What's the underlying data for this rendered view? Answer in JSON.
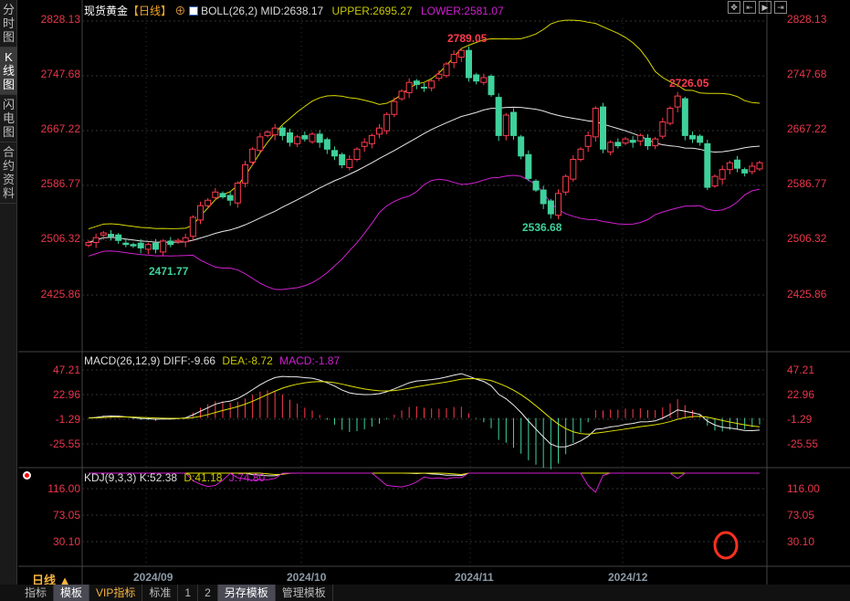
{
  "sidebar": {
    "items": [
      {
        "label": "分时图"
      },
      {
        "label": "K线图"
      },
      {
        "label": "闪电图"
      },
      {
        "label": "合约资料"
      }
    ]
  },
  "header": {
    "instrument": "现货黄金",
    "period": "【日线】",
    "indicator": "BOLL(26,2)",
    "mid": "MID:2638.17",
    "upper": "UPPER:2695.27",
    "lower": "LOWER:2581.07"
  },
  "price_axis": [
    "2828.13",
    "2747.68",
    "2667.22",
    "2586.77",
    "2506.32",
    "2425.86"
  ],
  "annotations": {
    "high": "2789.05",
    "low_left": "2471.77",
    "low_mid": "2536.68",
    "high_right": "2726.05"
  },
  "macd": {
    "title": "MACD(26,12,9)",
    "diff": "DIFF:-9.66",
    "dea": "DEA:-8.72",
    "macd": "MACD:-1.87",
    "axis": [
      "47.21",
      "22.96",
      "-1.29",
      "-25.55"
    ]
  },
  "kdj": {
    "title": "KDJ(9,3,3)",
    "k": "K:52.38",
    "d": "D:41.18",
    "j": "J:74.80",
    "axis": [
      "116.00",
      "73.05",
      "30.10"
    ]
  },
  "period_label": "日线 ▲",
  "dates": [
    "2024/09",
    "2024/10",
    "2024/11",
    "2024/12"
  ],
  "bottom_tabs": [
    "指标",
    "模板",
    "VIP指标",
    "标准",
    "1",
    "2",
    "另存模板",
    "管理模板"
  ],
  "colors": {
    "up": "#ff3b4e",
    "down": "#3fd19b",
    "mid": "#e8e8e8",
    "upper": "#d8d800",
    "lower": "#d020d0"
  },
  "chart_data": {
    "type": "candlestick",
    "ylim": [
      2425.86,
      2828.13
    ],
    "closes": [
      2503,
      2510,
      2517,
      2512,
      2506,
      2500,
      2498,
      2495,
      2500,
      2493,
      2505,
      2500,
      2506,
      2510,
      2540,
      2557,
      2565,
      2577,
      2570,
      2565,
      2590,
      2617,
      2640,
      2658,
      2665,
      2671,
      2660,
      2650,
      2658,
      2655,
      2662,
      2650,
      2640,
      2630,
      2617,
      2625,
      2640,
      2650,
      2660,
      2671,
      2691,
      2710,
      2725,
      2738,
      2735,
      2730,
      2740,
      2750,
      2765,
      2779,
      2785,
      2745,
      2740,
      2745,
      2720,
      2660,
      2690,
      2660,
      2630,
      2597,
      2580,
      2560,
      2545,
      2575,
      2600,
      2625,
      2640,
      2660,
      2700,
      2640,
      2650,
      2645,
      2655,
      2650,
      2660,
      2645,
      2655,
      2680,
      2700,
      2718,
      2660,
      2655,
      2650,
      2584,
      2600,
      2610,
      2620,
      2612,
      2605,
      2615,
      2620
    ]
  }
}
